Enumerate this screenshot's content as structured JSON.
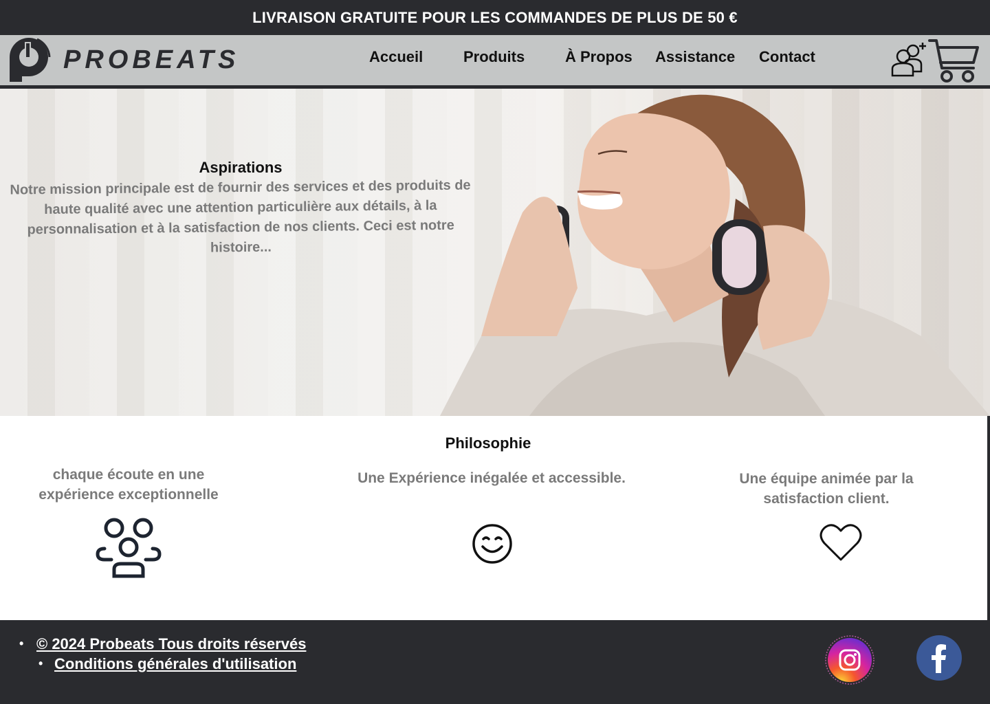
{
  "promo": {
    "text": "LIVRAISON GRATUITE POUR LES COMMANDES DE PLUS DE 50 €"
  },
  "brand": {
    "name": "PROBEATS"
  },
  "nav": {
    "items": [
      {
        "label": "Accueil"
      },
      {
        "label": "Produits"
      },
      {
        "label": "À Propos"
      },
      {
        "label": "Assistance"
      },
      {
        "label": "Contact"
      }
    ]
  },
  "header_icons": {
    "user": "add-user-icon",
    "cart": "cart-icon"
  },
  "hero": {
    "title": "Aspirations",
    "text": "Notre mission principale est de fournir des services et des produits de haute qualité avec une attention particulière aux détails, à la personnalisation et à la satisfaction de nos clients. Ceci est notre histoire..."
  },
  "philosophy": {
    "title": "Philosophie",
    "columns": [
      {
        "text": "chaque écoute en une expérience exceptionnelle",
        "icon": "team-icon"
      },
      {
        "text": "Une Expérience  inégalée et accessible.",
        "icon": "smile-icon"
      },
      {
        "text": "Une équipe animée par la satisfaction client.",
        "icon": "heart-icon"
      }
    ]
  },
  "footer": {
    "copyright": "© 2024  Probeats Tous droits réservés",
    "terms": "Conditions générales d'utilisation",
    "social": [
      "instagram-icon",
      "facebook-icon"
    ]
  },
  "colors": {
    "dark": "#2a2b2f",
    "header_bg": "#c4c6c6",
    "muted_text": "#7a7a7a",
    "facebook": "#3b5998"
  }
}
